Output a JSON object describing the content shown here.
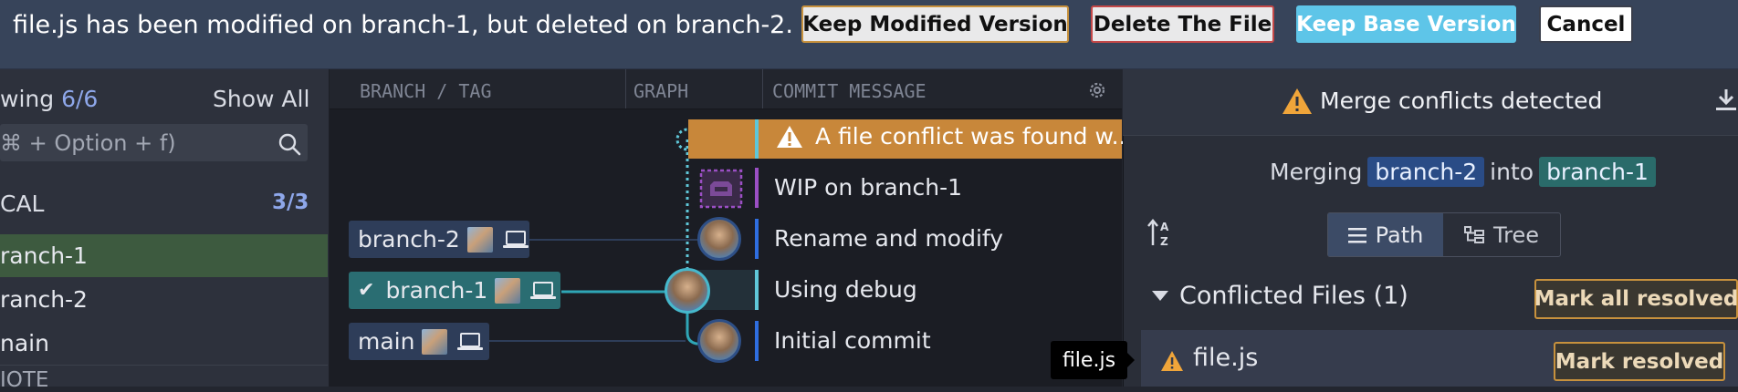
{
  "banner": {
    "message": "file.js has been modified on branch-1, but deleted on branch-2.",
    "keep_modified_label": "Keep Modified Version",
    "delete_file_label": "Delete The File",
    "keep_base_label": "Keep Base Version",
    "cancel_label": "Cancel"
  },
  "sidebar": {
    "showing_label": "wing",
    "showing_count": "6/6",
    "show_all_label": "Show All",
    "filter_placeholder": "⌘ + Option + f)",
    "local_header": "CAL",
    "local_count": "3/3",
    "items": [
      {
        "label": "ranch-1"
      },
      {
        "label": "ranch-2"
      },
      {
        "label": "nain"
      }
    ],
    "remote_header": "IOTE"
  },
  "graph": {
    "columns": {
      "branch": "BRANCH / TAG",
      "graph": "GRAPH",
      "message": "COMMIT MESSAGE"
    },
    "conflict_row": "A file conflict was found w...",
    "commits": [
      {
        "message": "WIP on branch-1"
      },
      {
        "message": "Rename and modify"
      },
      {
        "message": "Using debug"
      },
      {
        "message": "Initial commit"
      }
    ],
    "refs": [
      {
        "label": "branch-2"
      },
      {
        "label": "branch-1",
        "checked": "✔"
      },
      {
        "label": "main"
      }
    ]
  },
  "merge_panel": {
    "title": "Merge conflicts detected",
    "merging_word": "Merging",
    "from_branch": "branch-2",
    "into_word": "into",
    "into_branch": "branch-1",
    "view_path": "Path",
    "view_tree": "Tree",
    "conflicted_header": "Conflicted Files (1)",
    "mark_all_label": "Mark all resolved",
    "file_name": "file.js",
    "mark_resolved_label": "Mark resolved"
  },
  "tooltip": {
    "text": "file.js"
  },
  "colors": {
    "accent_teal": "#5fc7d8",
    "warning": "#c8873a",
    "selected_branch": "#3d5a3f"
  }
}
